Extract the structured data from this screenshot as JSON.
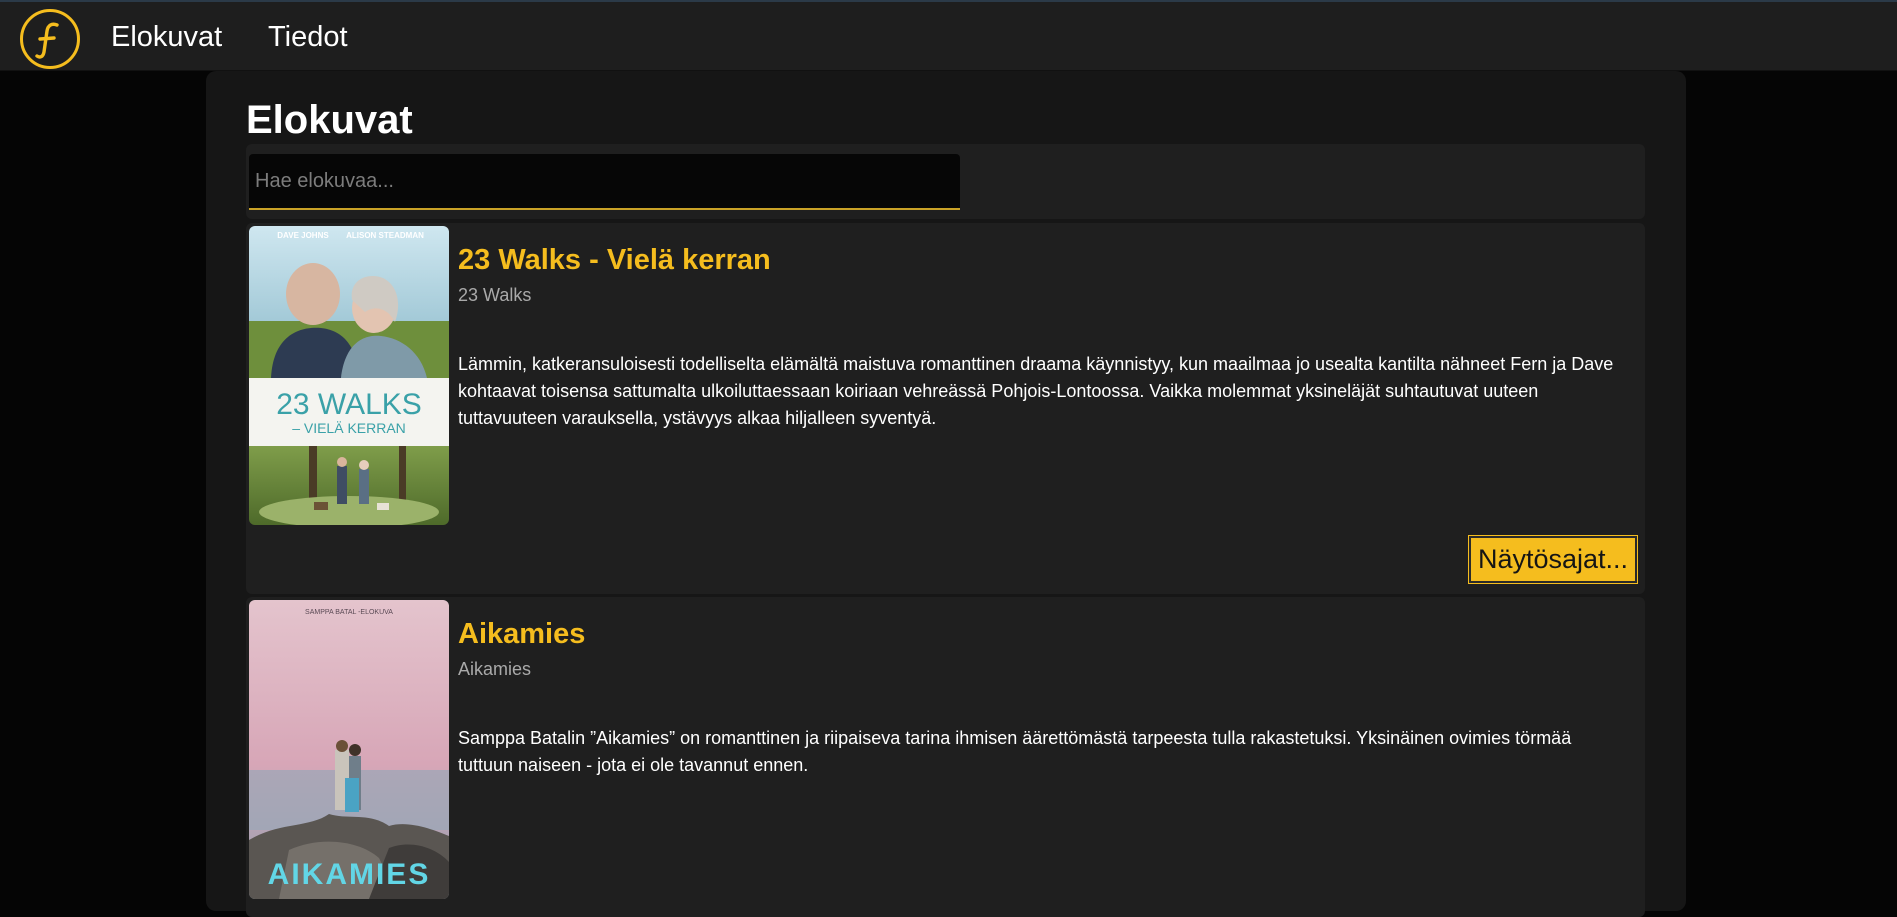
{
  "nav": {
    "logo_letter": "F",
    "links": [
      "Elokuvat",
      "Tiedot"
    ]
  },
  "page": {
    "title": "Elokuvat"
  },
  "search": {
    "placeholder": "Hae elokuvaa..."
  },
  "movies": [
    {
      "title": "23 Walks - Vielä kerran",
      "original_title": "23 Walks",
      "synopsis": "Lämmin, katkeransuloisesti todelliselta elämältä maistuva romanttinen draama käynnistyy, kun maailmaa jo usealta kantilta nähneet Fern ja Dave kohtaavat toisensa sattumalta ulkoiluttaessaan koiriaan vehreässä Pohjois-Lontoossa. Vaikka molemmat yksineläjät suhtautuvat uuteen tuttavuuteen varauksella, ystävyys alkaa hiljalleen syventyä.",
      "showtimes_label": "Näytösajat...",
      "poster": {
        "actors": [
          "DAVE JOHNS",
          "ALISON STEADMAN"
        ],
        "title_line1": "23 WALKS",
        "title_line2": "– VIELÄ KERRAN"
      }
    },
    {
      "title": "Aikamies",
      "original_title": "Aikamies",
      "synopsis": "Samppa Batalin ”Aikamies” on romanttinen ja riipaiseva tarina ihmisen äärettömästä tarpeesta tulla rakastetuksi. Yksinäinen ovimies törmää tuttuun naiseen - jota ei ole tavannut ennen.",
      "poster": {
        "tagline": "SAMPPA BATAL -ELOKUVA",
        "title": "AIKAMIES"
      }
    }
  ],
  "colors": {
    "accent": "#f5bd1e",
    "background": "#050505",
    "panel": "#1f1f1f",
    "container": "#161616"
  }
}
